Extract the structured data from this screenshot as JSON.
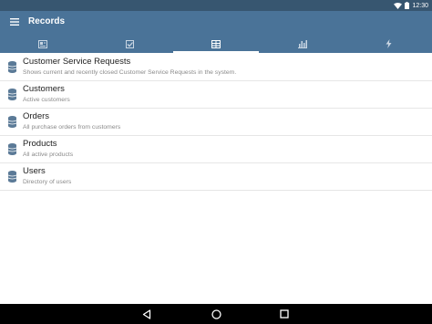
{
  "status_bar": {
    "time": "12:30",
    "icons": [
      "wifi-icon",
      "battery-icon"
    ]
  },
  "app_bar": {
    "title": "Records",
    "menu_icon": "hamburger-menu-icon",
    "background": "#4a7398"
  },
  "tabs": [
    {
      "icon": "contact-card-icon",
      "active": false
    },
    {
      "icon": "checkbox-icon",
      "active": false
    },
    {
      "icon": "records-list-icon",
      "active": true
    },
    {
      "icon": "bar-chart-icon",
      "active": false
    },
    {
      "icon": "lightning-icon",
      "active": false
    }
  ],
  "records": [
    {
      "title": "Customer Service Requests",
      "subtitle": "Shows current and recently closed Customer Service Requests in the system."
    },
    {
      "title": "Customers",
      "subtitle": "Active customers"
    },
    {
      "title": "Orders",
      "subtitle": "All purchase orders from customers"
    },
    {
      "title": "Products",
      "subtitle": "All active products"
    },
    {
      "title": "Users",
      "subtitle": "Directory of users"
    }
  ],
  "record_icon": "database-icon",
  "nav_bar": {
    "icons": [
      "back-icon",
      "home-icon",
      "recents-icon"
    ]
  }
}
